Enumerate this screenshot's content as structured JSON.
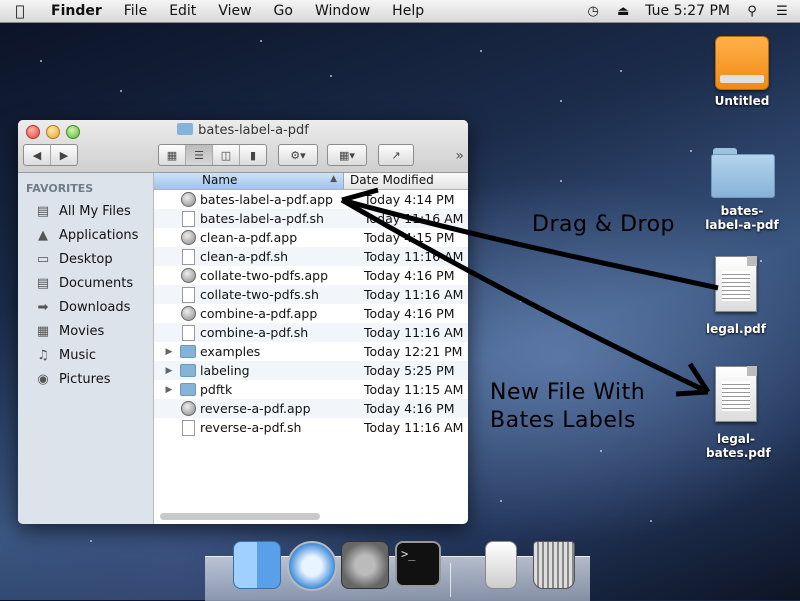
{
  "menubar": {
    "app_name": "Finder",
    "menus": [
      "File",
      "Edit",
      "View",
      "Go",
      "Window",
      "Help"
    ],
    "clock": "Tue 5:27 PM"
  },
  "desktop": {
    "icons": [
      {
        "label": "Untitled",
        "kind": "hard-drive-icon"
      },
      {
        "label": "bates-label-a-pdf",
        "kind": "folder-icon"
      },
      {
        "label": "legal.pdf",
        "kind": "pdf-document-icon"
      },
      {
        "label": "legal-bates.pdf",
        "kind": "pdf-document-icon"
      }
    ],
    "annotations": {
      "drag_drop": "Drag & Drop",
      "new_file_line1": "New File With",
      "new_file_line2": "Bates Labels"
    }
  },
  "finder": {
    "title": "bates-label-a-pdf",
    "sidebar_heading": "FAVORITES",
    "sidebar": [
      {
        "label": "All My Files",
        "icon": "all-files-icon"
      },
      {
        "label": "Applications",
        "icon": "applications-icon"
      },
      {
        "label": "Desktop",
        "icon": "desktop-icon"
      },
      {
        "label": "Documents",
        "icon": "documents-icon"
      },
      {
        "label": "Downloads",
        "icon": "downloads-icon"
      },
      {
        "label": "Movies",
        "icon": "movies-icon"
      },
      {
        "label": "Music",
        "icon": "music-icon"
      },
      {
        "label": "Pictures",
        "icon": "pictures-icon"
      }
    ],
    "columns": {
      "name": "Name",
      "date": "Date Modified"
    },
    "files": [
      {
        "name": "bates-label-a-pdf.app",
        "date": "Today 4:14 PM",
        "type": "app"
      },
      {
        "name": "bates-label-a-pdf.sh",
        "date": "Today 11:16 AM",
        "type": "doc"
      },
      {
        "name": "clean-a-pdf.app",
        "date": "Today 4:15 PM",
        "type": "app"
      },
      {
        "name": "clean-a-pdf.sh",
        "date": "Today 11:16 AM",
        "type": "doc"
      },
      {
        "name": "collate-two-pdfs.app",
        "date": "Today 4:16 PM",
        "type": "app"
      },
      {
        "name": "collate-two-pdfs.sh",
        "date": "Today 11:16 AM",
        "type": "doc"
      },
      {
        "name": "combine-a-pdf.app",
        "date": "Today 4:16 PM",
        "type": "app"
      },
      {
        "name": "combine-a-pdf.sh",
        "date": "Today 11:16 AM",
        "type": "doc"
      },
      {
        "name": "examples",
        "date": "Today 12:21 PM",
        "type": "folder"
      },
      {
        "name": "labeling",
        "date": "Today 5:25 PM",
        "type": "folder"
      },
      {
        "name": "pdftk",
        "date": "Today 11:15 AM",
        "type": "folder"
      },
      {
        "name": "reverse-a-pdf.app",
        "date": "Today 4:16 PM",
        "type": "app"
      },
      {
        "name": "reverse-a-pdf.sh",
        "date": "Today 11:16 AM",
        "type": "doc"
      }
    ]
  },
  "dock": {
    "items": [
      "finder-icon",
      "safari-icon",
      "system-preferences-icon",
      "terminal-icon",
      "documents-stack-icon",
      "trash-icon"
    ],
    "terminal_prompt": ">_"
  }
}
